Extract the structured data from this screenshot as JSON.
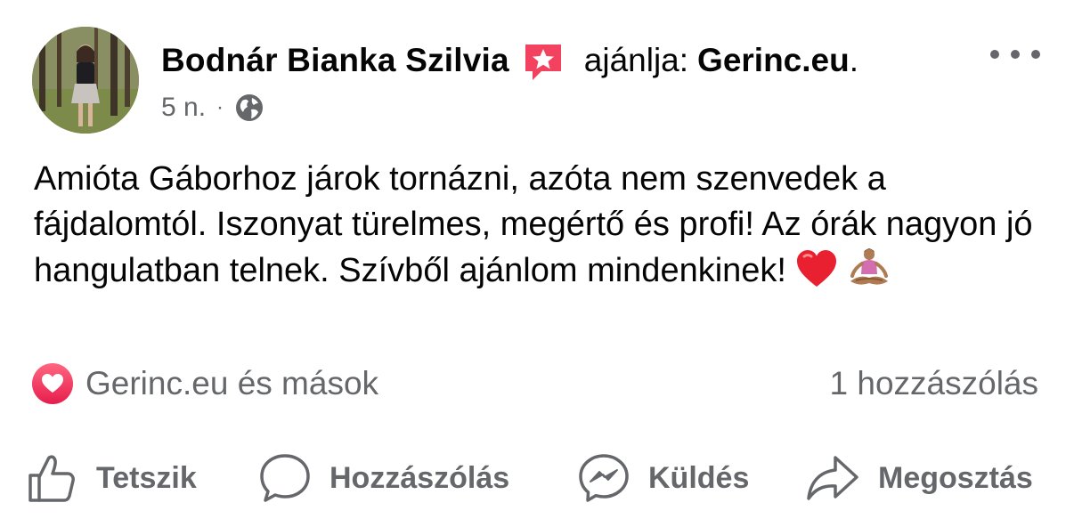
{
  "post": {
    "author": "Bodnár Bianka Szilvia",
    "recommends_text": "ajánlja:",
    "page_name": "Gerinc.eu",
    "page_suffix": ".",
    "time": "5 n.",
    "separator": "·",
    "audience_icon": "globe-icon",
    "more_icon": "more-dots-icon",
    "body_text": "Amióta Gáborhoz járok tornázni, azóta nem szenvedek a fájdalomtól. Iszonyat türelmes, megértő és profi! Az órák nagyon jó hangulatban telnek. Szívből ajánlom mindenkinek!",
    "body_emojis": [
      "red-heart-icon",
      "person-in-lotus-position-icon"
    ]
  },
  "reactions": {
    "icon": "love-reaction-icon",
    "summary": "Gerinc.eu és mások",
    "comments": "1 hozzászólás"
  },
  "actions": {
    "like": "Tetszik",
    "comment": "Hozzászólás",
    "send": "Küldés",
    "share": "Megosztás"
  },
  "colors": {
    "text": "#050505",
    "secondary": "#65676b",
    "love": "#e61e4d",
    "recommend_badge": "#f3425f"
  }
}
